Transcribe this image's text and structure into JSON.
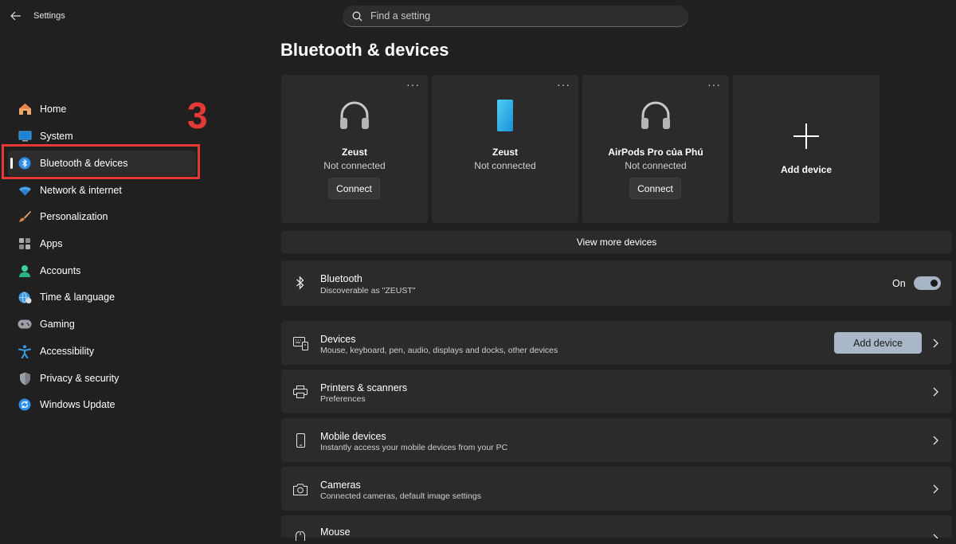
{
  "window": {
    "title": "Settings"
  },
  "search": {
    "placeholder": "Find a setting"
  },
  "sidebar": {
    "items": [
      {
        "label": "Home"
      },
      {
        "label": "System"
      },
      {
        "label": "Bluetooth & devices"
      },
      {
        "label": "Network & internet"
      },
      {
        "label": "Personalization"
      },
      {
        "label": "Apps"
      },
      {
        "label": "Accounts"
      },
      {
        "label": "Time & language"
      },
      {
        "label": "Gaming"
      },
      {
        "label": "Accessibility"
      },
      {
        "label": "Privacy & security"
      },
      {
        "label": "Windows Update"
      }
    ],
    "active": "Bluetooth & devices"
  },
  "annotation": {
    "step": "3",
    "color": "#e53935"
  },
  "page": {
    "title": "Bluetooth & devices"
  },
  "devices": [
    {
      "name": "Zeust",
      "status": "Not connected",
      "action": "Connect",
      "icon": "headphones-icon"
    },
    {
      "name": "Zeust",
      "status": "Not connected",
      "icon": "phone-icon"
    },
    {
      "name": "AirPods Pro của Phú",
      "status": "Not connected",
      "action": "Connect",
      "icon": "headphones-icon"
    }
  ],
  "more_glyph": "···",
  "add_device_card": {
    "label": "Add device"
  },
  "view_more": {
    "label": "View more devices"
  },
  "bluetooth": {
    "title": "Bluetooth",
    "subtitle": "Discoverable as \"ZEUST\"",
    "state_label": "On"
  },
  "rows": [
    {
      "title": "Devices",
      "subtitle": "Mouse, keyboard, pen, audio, displays and docks, other devices",
      "button": "Add device"
    },
    {
      "title": "Printers & scanners",
      "subtitle": "Preferences"
    },
    {
      "title": "Mobile devices",
      "subtitle": "Instantly access your mobile devices from your PC"
    },
    {
      "title": "Cameras",
      "subtitle": "Connected cameras, default image settings"
    },
    {
      "title": "Mouse"
    }
  ],
  "colors": {
    "background": "#202020",
    "card": "#2b2b2b",
    "accent": "#0078d4",
    "toggle_on": "#a7b4c5"
  }
}
